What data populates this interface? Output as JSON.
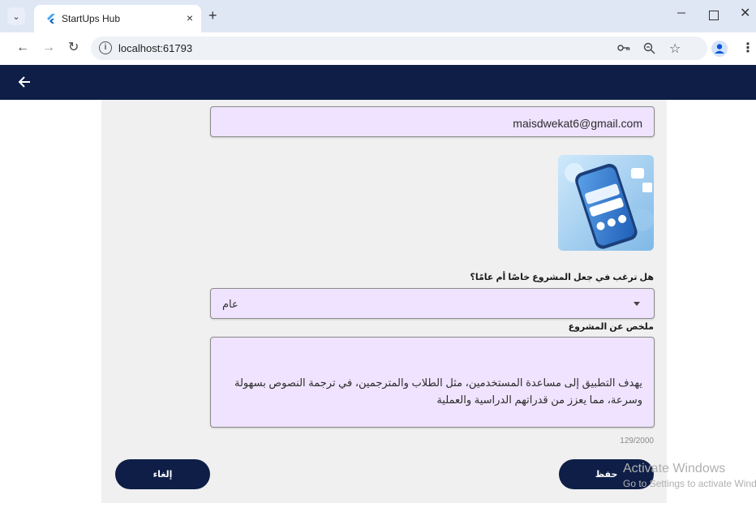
{
  "browser": {
    "tab_title": "StartUps Hub",
    "tab_close": "×",
    "new_tab": "+",
    "url": "localhost:61793",
    "icons": [
      "tab-dropdown-icon",
      "flutter-favicon-icon",
      "back-icon",
      "forward-icon",
      "reload-icon",
      "info-icon",
      "password-key-icon",
      "zoom-icon",
      "star-icon",
      "profile-icon",
      "menu-icon",
      "minimize-icon",
      "maximize-icon",
      "close-icon"
    ]
  },
  "appbar": {
    "color": "#0e1e47",
    "back_icon": "arrow-left-icon"
  },
  "form": {
    "email": "maisdwekat6@gmail.com",
    "image": "project-image-thumbnail",
    "visibility_label": "هل ترغب في جعل المشروع خاصًا أم عامًا؟",
    "visibility_value": "عام",
    "summary_label": "ملخص عن المشروع",
    "summary_text": "يهدف التطبيق إلى مساعدة المستخدمين، مثل الطلاب والمترجمين، في ترجمة النصوص بسهولة وسرعة، مما يعزز من قدراتهم الدراسية والعملية",
    "char_counter": "129/2000",
    "field_fill": "#efe3ff"
  },
  "actions": {
    "cancel": "إلغاء",
    "save": "حفظ"
  },
  "watermark": {
    "line1": "Activate Windows",
    "line2": "Go to Settings to activate Windows."
  }
}
